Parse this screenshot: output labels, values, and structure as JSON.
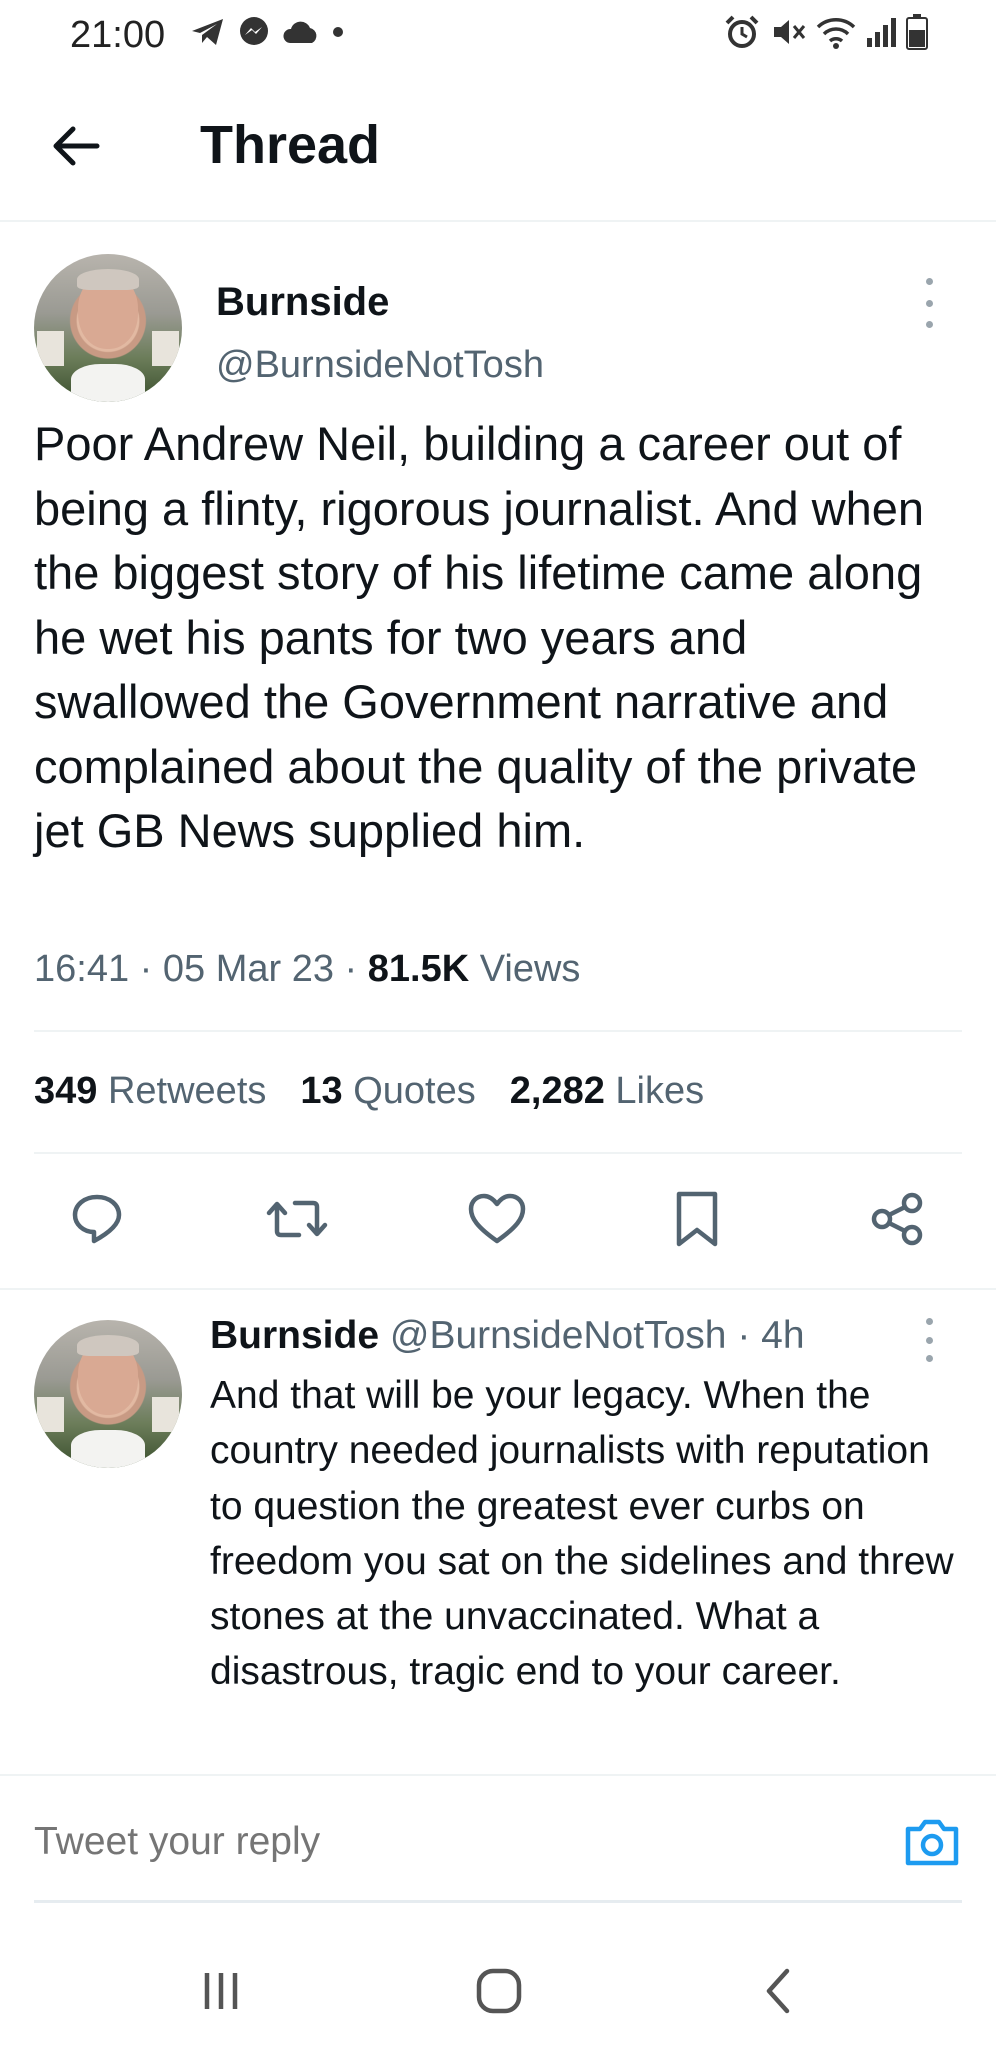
{
  "status_bar": {
    "time": "21:00",
    "left_icons": [
      "telegram-icon",
      "messenger-icon",
      "cloud-icon",
      "dot-icon"
    ],
    "right_icons": [
      "alarm-icon",
      "mute-icon",
      "wifi-icon",
      "signal-icon",
      "battery-icon"
    ]
  },
  "header": {
    "title": "Thread",
    "back_icon": "arrow-left-icon"
  },
  "main_tweet": {
    "name": "Burnside",
    "handle": "@BurnsideNotTosh",
    "text": "Poor Andrew Neil, building a career out of being a flinty, rigorous journalist. And when the biggest story of his lifetime came along he wet his pants for two years and swallowed the Government narrative and complained about the quality of the private jet GB News supplied him.",
    "time": "16:41",
    "date": "05 Mar 23",
    "views_count": "81.5K",
    "views_label": "Views",
    "stats": {
      "retweets_count": "349",
      "retweets_label": "Retweets",
      "quotes_count": "13",
      "quotes_label": "Quotes",
      "likes_count": "2,282",
      "likes_label": "Likes"
    },
    "actions": [
      "reply-icon",
      "retweet-icon",
      "like-icon",
      "bookmark-icon",
      "share-icon"
    ]
  },
  "reply_tweet": {
    "name": "Burnside",
    "handle": "@BurnsideNotTosh",
    "age": "4h",
    "text": "And that will be your legacy. When the country needed journalists with reputation to question the greatest ever curbs on freedom you sat on the sidelines and threw stones at the unvaccinated. What a disastrous, tragic end to your career."
  },
  "compose": {
    "placeholder": "Tweet your reply",
    "camera_icon": "camera-icon"
  },
  "colors": {
    "text": "#0f1419",
    "secondary": "#536471",
    "accent": "#1d9bf0",
    "divider": "#eff3f4"
  },
  "nav_bar": {
    "buttons": [
      "recent-apps-icon",
      "home-icon",
      "back-icon"
    ]
  }
}
